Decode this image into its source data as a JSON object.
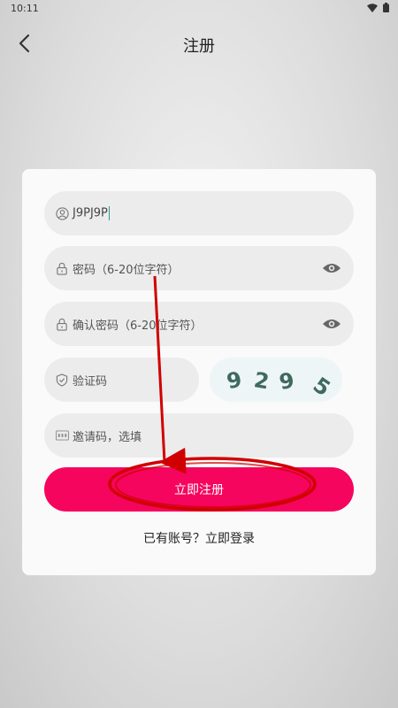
{
  "status": {
    "time": "10:11"
  },
  "header": {
    "title": "注册"
  },
  "form": {
    "username_value": "J9PJ9P",
    "password_placeholder": "密码（6-20位字符）",
    "confirm_placeholder": "确认密码（6-20位字符）",
    "captcha_placeholder": "验证码",
    "captcha_code": [
      "9",
      "2",
      "9",
      "5"
    ],
    "invite_placeholder": "邀请码，选填",
    "register_label": "立即注册",
    "login_link": "已有账号？立即登录"
  },
  "icons": {
    "user": "user-icon",
    "lock": "lock-icon",
    "eye": "eye-icon",
    "shield": "shield-icon",
    "invite": "invite-code-icon",
    "back": "back-arrow-icon"
  },
  "colors": {
    "accent": "#f5055e",
    "annotation": "#d00000",
    "captcha_text": "#3f6b5c"
  }
}
